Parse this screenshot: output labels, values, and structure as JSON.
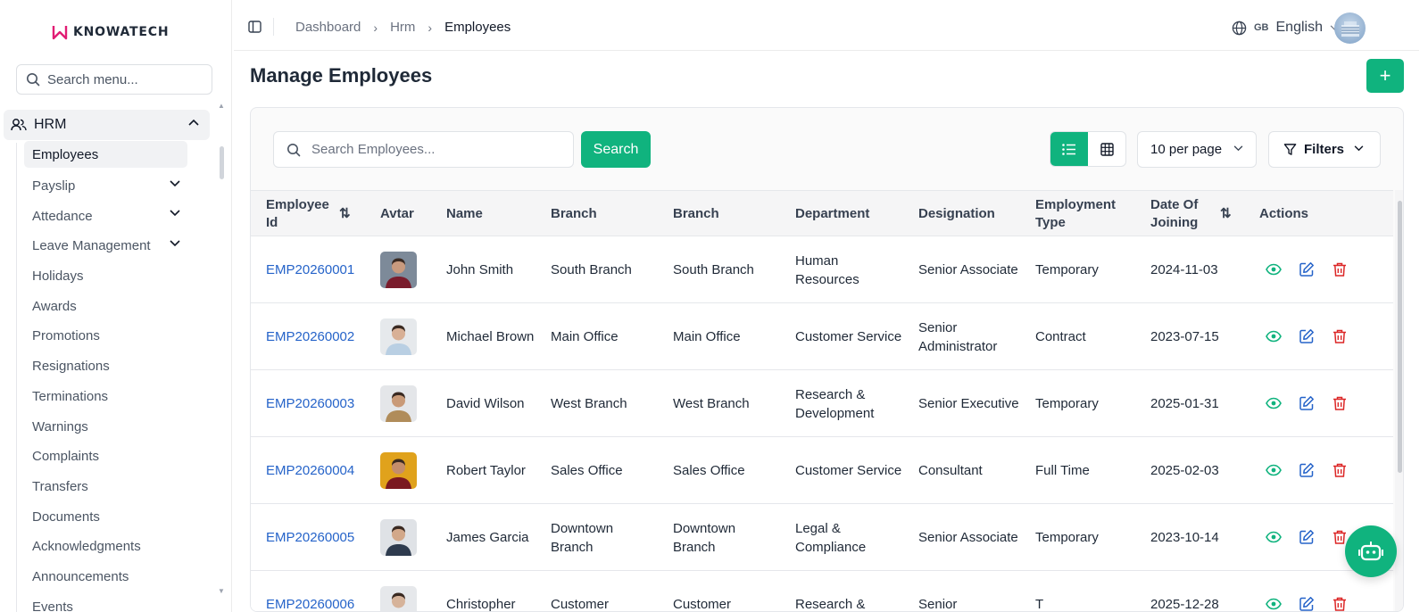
{
  "brand": {
    "name": "KNOWATECH",
    "accent": "#10b37e",
    "link": "#2563c9",
    "danger": "#dc2626"
  },
  "sidebar": {
    "search_placeholder": "Search menu...",
    "group_label": "HRM",
    "items": [
      {
        "label": "Employees",
        "active": true
      },
      {
        "label": "Payslip",
        "expandable": true
      },
      {
        "label": "Attedance",
        "expandable": true
      },
      {
        "label": "Leave Management",
        "expandable": true
      },
      {
        "label": "Holidays"
      },
      {
        "label": "Awards"
      },
      {
        "label": "Promotions"
      },
      {
        "label": "Resignations"
      },
      {
        "label": "Terminations"
      },
      {
        "label": "Warnings"
      },
      {
        "label": "Complaints"
      },
      {
        "label": "Transfers"
      },
      {
        "label": "Documents"
      },
      {
        "label": "Acknowledgments"
      },
      {
        "label": "Announcements"
      },
      {
        "label": "Events"
      }
    ]
  },
  "topbar": {
    "breadcrumb": [
      "Dashboard",
      "Hrm",
      "Employees"
    ],
    "language_flag": "GB",
    "language": "English"
  },
  "main": {
    "title": "Manage Employees",
    "search_placeholder": "Search Employees...",
    "search_button": "Search",
    "per_page": "10 per page",
    "filters_label": "Filters"
  },
  "table": {
    "headers": {
      "employee_id": "Employee Id",
      "avatar": "Avtar",
      "name": "Name",
      "branch": "Branch",
      "branch2": "Branch",
      "department": "Department",
      "designation": "Designation",
      "employment_type": "Employment Type",
      "date_of_joining": "Date Of Joining",
      "actions": "Actions"
    },
    "rows": [
      {
        "id": "EMP20260001",
        "name": "John Smith",
        "branch": "South Branch",
        "branch2": "South Branch",
        "department": "Human Resources",
        "designation": "Senior Associate",
        "type": "Temporary",
        "doj": "2024-11-03"
      },
      {
        "id": "EMP20260002",
        "name": "Michael Brown",
        "branch": "Main Office",
        "branch2": "Main Office",
        "department": "Customer Service",
        "designation": "Senior Administrator",
        "type": "Contract",
        "doj": "2023-07-15"
      },
      {
        "id": "EMP20260003",
        "name": "David Wilson",
        "branch": "West Branch",
        "branch2": "West Branch",
        "department": "Research & Development",
        "designation": "Senior Executive",
        "type": "Temporary",
        "doj": "2025-01-31"
      },
      {
        "id": "EMP20260004",
        "name": "Robert Taylor",
        "branch": "Sales Office",
        "branch2": "Sales Office",
        "department": "Customer Service",
        "designation": "Consultant",
        "type": "Full Time",
        "doj": "2025-02-03"
      },
      {
        "id": "EMP20260005",
        "name": "James Garcia",
        "branch": "Downtown Branch",
        "branch2": "Downtown Branch",
        "department": "Legal & Compliance",
        "designation": "Senior Associate",
        "type": "Temporary",
        "doj": "2023-10-14"
      },
      {
        "id": "EMP20260006",
        "name": "Christopher",
        "branch": "Customer",
        "branch2": "Customer",
        "department": "Research &",
        "designation": "Senior",
        "type": "T",
        "doj": "2025-12-28"
      }
    ]
  }
}
